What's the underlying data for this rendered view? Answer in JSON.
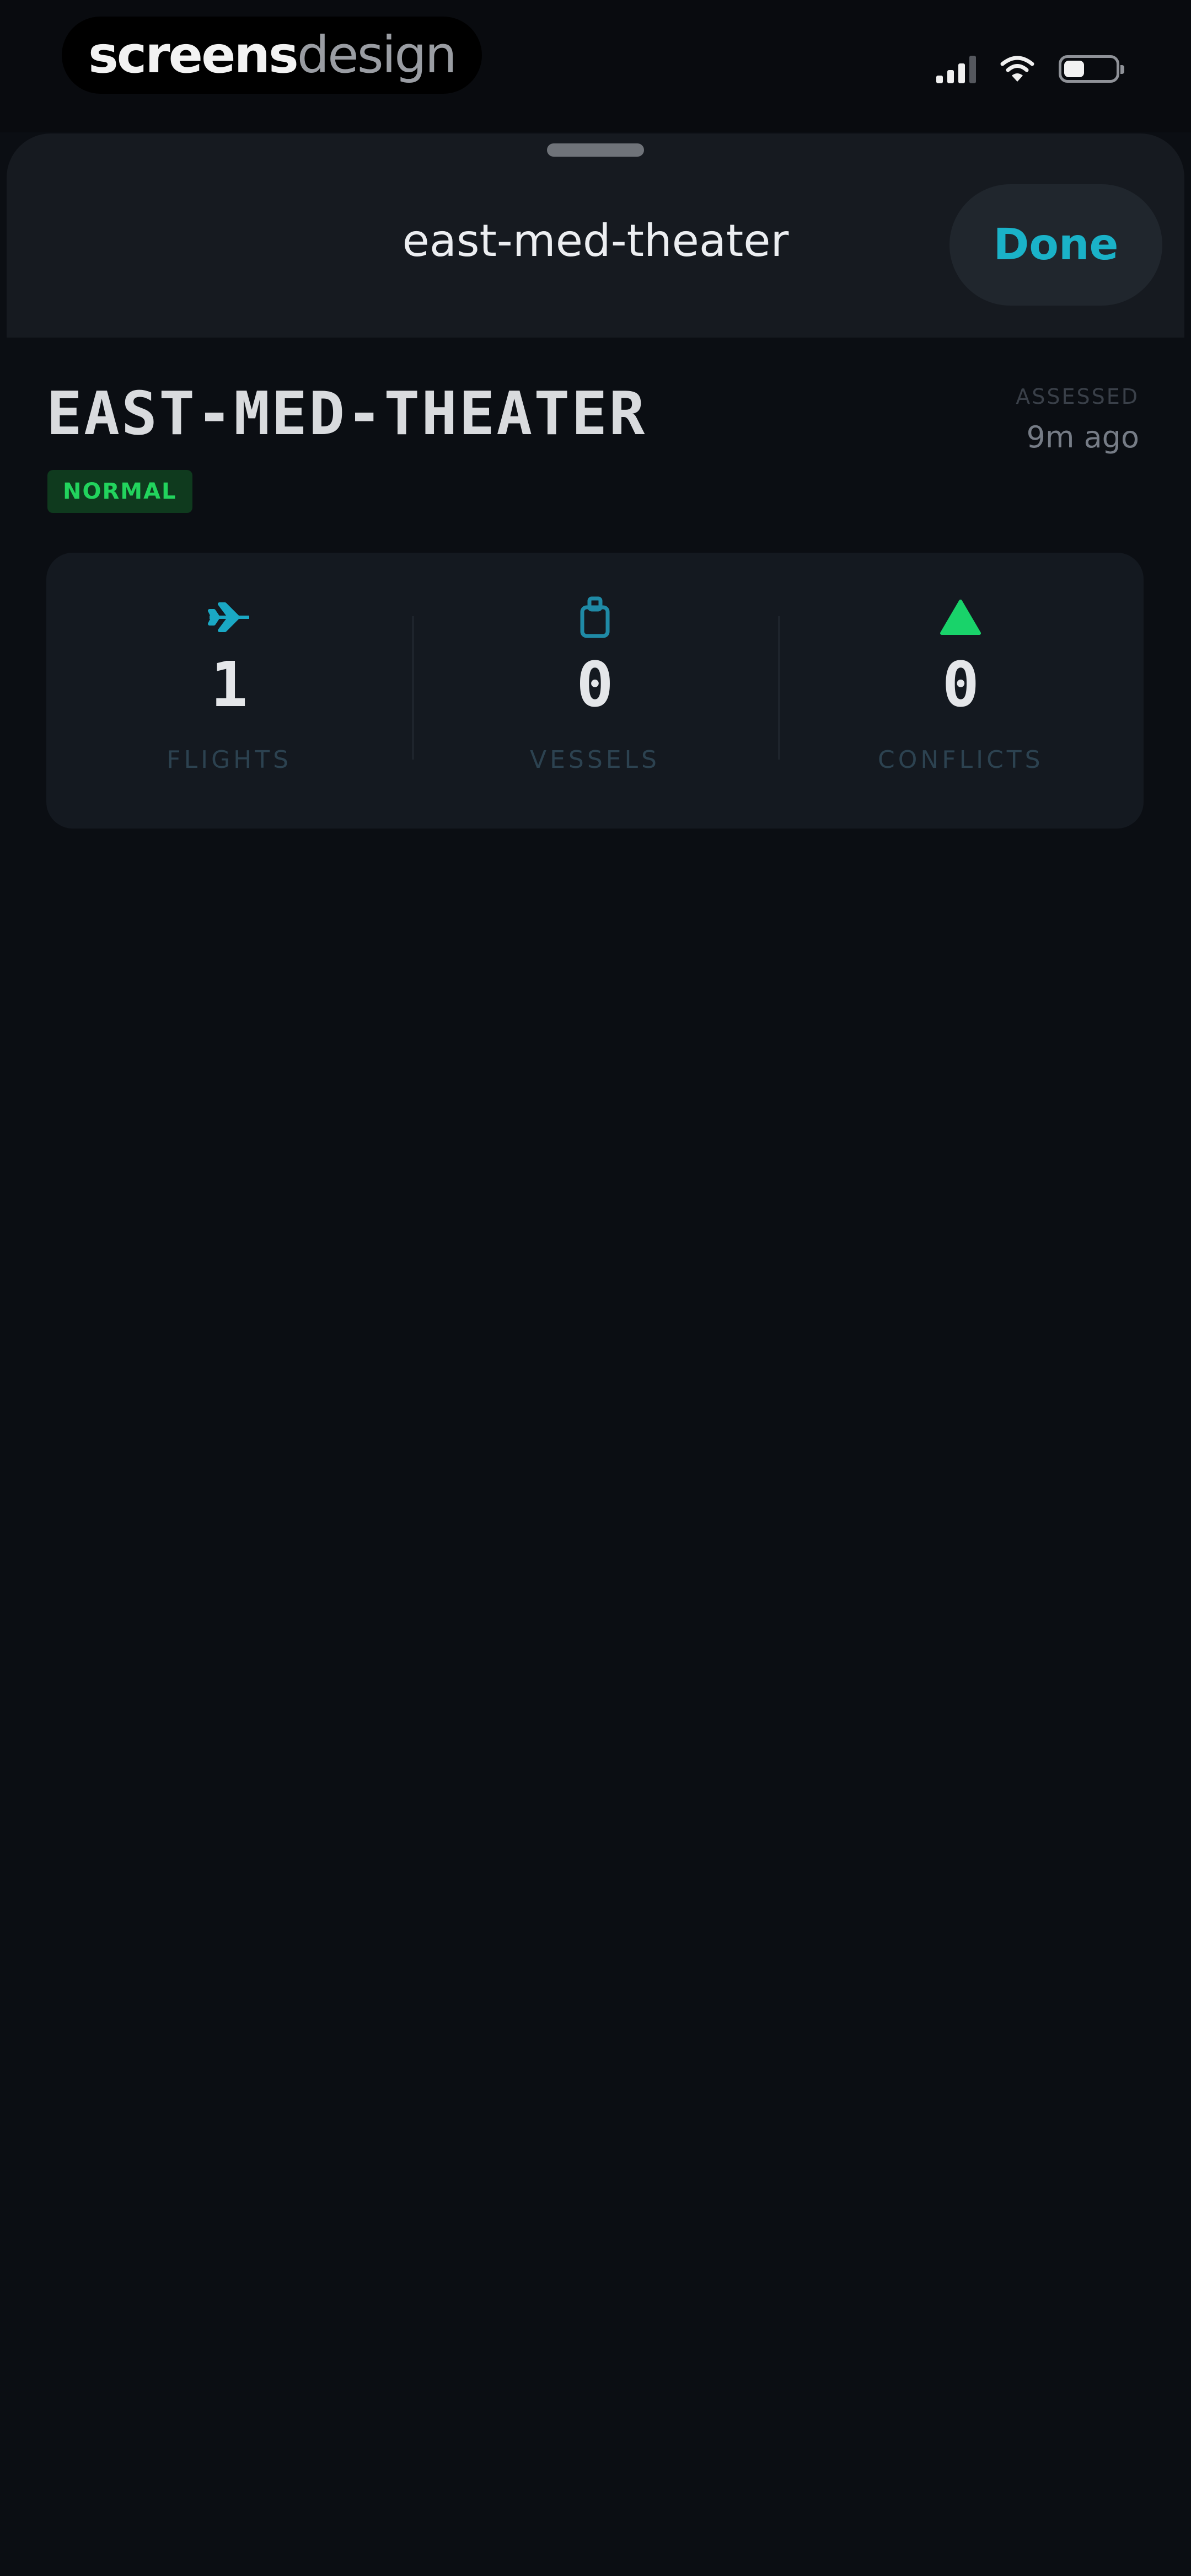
{
  "status_bar": {
    "watermark_bold": "screens",
    "watermark_light": "design",
    "battery_level_fraction": 0.4
  },
  "sheet": {
    "title": "east-med-theater",
    "done_label": "Done"
  },
  "theater": {
    "name": "EAST-MED-THEATER",
    "status": "NORMAL",
    "assessed_label": "ASSESSED",
    "assessed_time": "9m ago"
  },
  "stats": [
    {
      "icon": "airplane-icon",
      "value": "1",
      "label": "FLIGHTS"
    },
    {
      "icon": "vessel-icon",
      "value": "0",
      "label": "VESSELS"
    },
    {
      "icon": "conflict-triangle-icon",
      "value": "0",
      "label": "CONFLICTS"
    }
  ],
  "colors": {
    "background": "#0b0e13",
    "accent": "#1ab2c8",
    "status_normal": "#22d35d",
    "conflict": "#19d36a"
  }
}
